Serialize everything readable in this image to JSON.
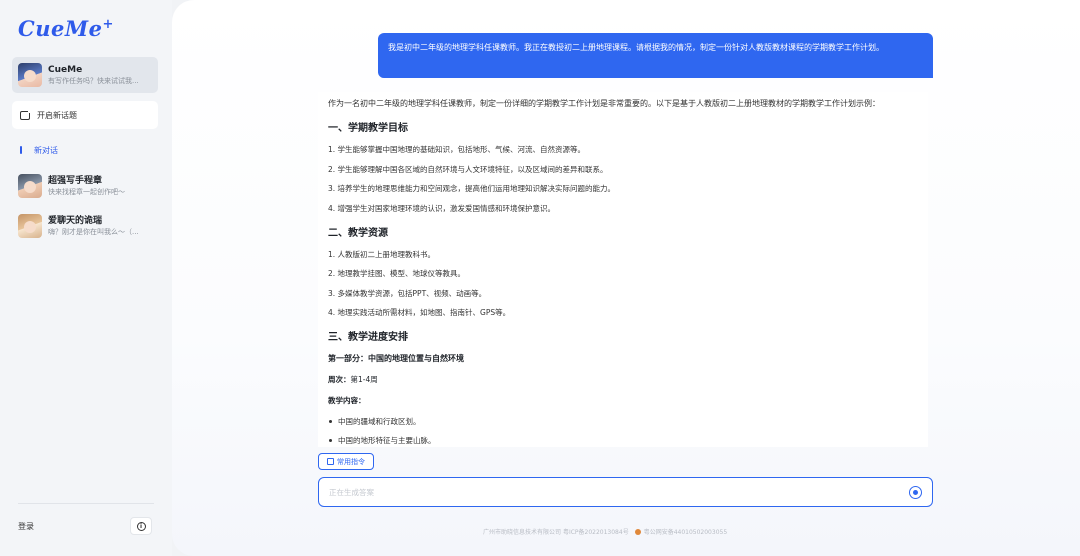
{
  "sidebar": {
    "logo": "CueMe",
    "logo_plus": "+",
    "bot": {
      "name": "CueMe",
      "subtitle": "有写作任务吗？快来试试我..."
    },
    "new_topic_label": "开启新话题",
    "new_chat_label": "新对话",
    "chats": [
      {
        "name": "超强写手程章",
        "preview": "快来找程章一起创作吧～"
      },
      {
        "name": "爱聊天的诡瑞",
        "preview": "嗨？刚才是你在叫我么～（..."
      }
    ],
    "login_label": "登录",
    "info_glyph": "i"
  },
  "conversation": {
    "user_message": "我是初中二年级的地理学科任课教师。我正在教授初二上册地理课程。请根据我的情况，制定一份针对人教版教材课程的学期教学工作计划。",
    "answer": {
      "intro": "作为一名初中二年级的地理学科任课教师，制定一份详细的学期教学工作计划是非常重要的。以下是基于人教版初二上册地理教材的学期教学工作计划示例：",
      "section1_title": "一、学期教学目标",
      "section1_items": [
        "1. 学生能够掌握中国地理的基础知识，包括地形、气候、河流、自然资源等。",
        "2. 学生能够理解中国各区域的自然环境与人文环境特征，以及区域间的差异和联系。",
        "3. 培养学生的地理思维能力和空间观念，提高他们运用地理知识解决实际问题的能力。",
        "4. 增强学生对国家地理环境的认识，激发爱国情感和环境保护意识。"
      ],
      "section2_title": "二、教学资源",
      "section2_items": [
        "1. 人教版初二上册地理教科书。",
        "2. 地理教学挂图、模型、地球仪等教具。",
        "3. 多媒体教学资源，包括PPT、视频、动画等。",
        "4. 地理实践活动所需材料，如地图、指南针、GPS等。"
      ],
      "section3_title": "三、教学进度安排",
      "part1_title": "第一部分：中国的地理位置与自然环境",
      "week_label": "周次：",
      "week_value": "第1-4周",
      "content_label": "教学内容：",
      "content_items": [
        "中国的疆域和行政区划。",
        "中国的地形特征与主要山脉。"
      ]
    }
  },
  "composer": {
    "common_commands_label": "常用指令",
    "input_placeholder": "正在生成答案",
    "input_value": ""
  },
  "footer": {
    "company": "广州市助晓信息技术有限公司",
    "icp": "粤ICP备2022013084号",
    "police": "粤公网安备44010502003055"
  },
  "colors": {
    "accent": "#2f67f0",
    "logo": "#2f5bea",
    "sidebar_bg": "#f3f5f8"
  }
}
